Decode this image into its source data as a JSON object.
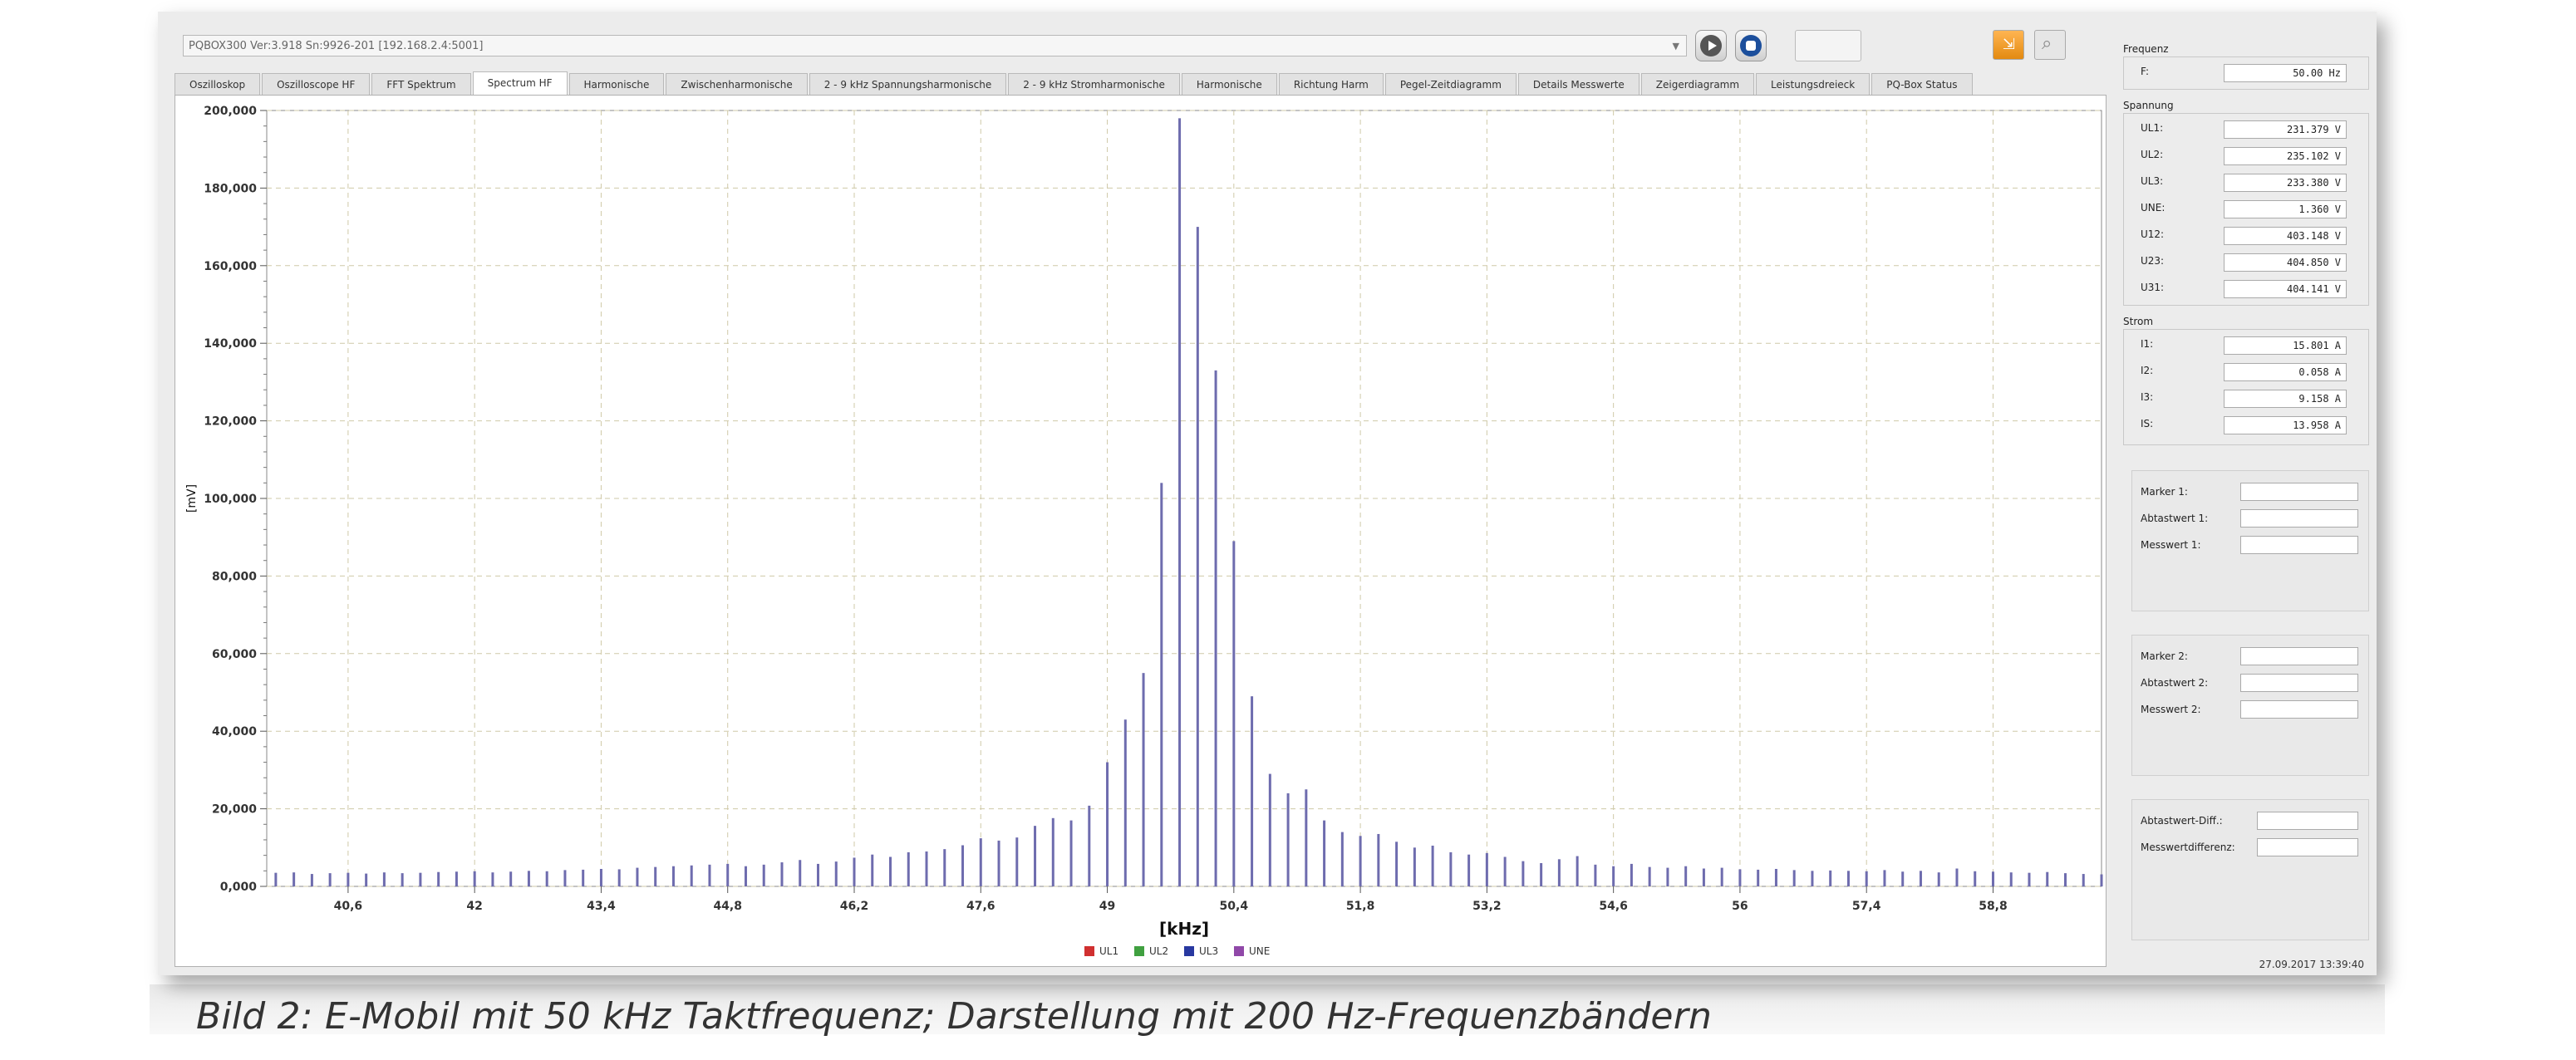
{
  "device_select": "PQBOX300 Ver:3.918 Sn:9926-201 [192.168.2.4:5001]",
  "tabs": [
    "Oszilloskop",
    "Oszilloscope HF",
    "FFT Spektrum",
    "Spectrum HF",
    "Harmonische",
    "Zwischenharmonische",
    "2 - 9 kHz Spannungsharmonische",
    "2 - 9 kHz Stromharmonische",
    "Harmonische",
    "Richtung Harm",
    "Pegel-Zeitdiagramm",
    "Details Messwerte",
    "Zeigerdiagramm",
    "Leistungsdreieck",
    "PQ-Box Status"
  ],
  "active_tab_index": 3,
  "side": {
    "frequenz": {
      "title": "Frequenz",
      "rows": [
        {
          "label": "F:",
          "value": "50.00 Hz"
        }
      ]
    },
    "spannung": {
      "title": "Spannung",
      "rows": [
        {
          "label": "UL1:",
          "value": "231.379 V"
        },
        {
          "label": "UL2:",
          "value": "235.102 V"
        },
        {
          "label": "UL3:",
          "value": "233.380 V"
        },
        {
          "label": "UNE:",
          "value": "1.360 V"
        },
        {
          "label": "U12:",
          "value": "403.148 V"
        },
        {
          "label": "U23:",
          "value": "404.850 V"
        },
        {
          "label": "U31:",
          "value": "404.141 V"
        }
      ]
    },
    "strom": {
      "title": "Strom",
      "rows": [
        {
          "label": "I1:",
          "value": "15.801 A"
        },
        {
          "label": "I2:",
          "value": "0.058 A"
        },
        {
          "label": "I3:",
          "value": "9.158 A"
        },
        {
          "label": "IS:",
          "value": "13.958 A"
        }
      ]
    },
    "marker1": [
      "Marker 1:",
      "Abtastwert 1:",
      "Messwert 1:"
    ],
    "marker2": [
      "Marker 2:",
      "Abtastwert 2:",
      "Messwert 2:"
    ],
    "diff": [
      "Abtastwert-Diff.:",
      "Messwertdifferenz:"
    ],
    "timestamp": "27.09.2017 13:39:40"
  },
  "caption": "Bild 2: E-Mobil mit 50 kHz Taktfrequenz; Darstellung mit 200 Hz-Frequenzbändern",
  "chart_data": {
    "type": "bar",
    "xlabel": "[kHz]",
    "ylabel": "[mV]",
    "xlim": [
      39.7,
      60.0
    ],
    "ylim": [
      0,
      200000
    ],
    "x_ticks": [
      "40,6",
      "42",
      "43,4",
      "44,8",
      "46,2",
      "47,6",
      "49",
      "50,4",
      "51,8",
      "53,2",
      "54,6",
      "56",
      "57,4",
      "58,8"
    ],
    "x_tick_values": [
      40.6,
      42,
      43.4,
      44.8,
      46.2,
      47.6,
      49,
      50.4,
      51.8,
      53.2,
      54.6,
      56,
      57.4,
      58.8
    ],
    "y_ticks": [
      "0,000",
      "20,000",
      "40,000",
      "60,000",
      "80,000",
      "100,000",
      "120,000",
      "140,000",
      "160,000",
      "180,000",
      "200,000"
    ],
    "y_tick_values": [
      0,
      20000,
      40000,
      60000,
      80000,
      100000,
      120000,
      140000,
      160000,
      180000,
      200000
    ],
    "grid": true,
    "legend": [
      {
        "name": "UL1",
        "color": "#d03030"
      },
      {
        "name": "UL2",
        "color": "#40a040"
      },
      {
        "name": "UL3",
        "color": "#2838a0"
      },
      {
        "name": "UNE",
        "color": "#9048a8"
      }
    ],
    "bar_color": "#6e6cae",
    "series": [
      {
        "name": "UL3",
        "x": [
          39.8,
          40.0,
          40.2,
          40.4,
          40.6,
          40.8,
          41.0,
          41.2,
          41.4,
          41.6,
          41.8,
          42.0,
          42.2,
          42.4,
          42.6,
          42.8,
          43.0,
          43.2,
          43.4,
          43.6,
          43.8,
          44.0,
          44.2,
          44.4,
          44.6,
          44.8,
          45.0,
          45.2,
          45.4,
          45.6,
          45.8,
          46.0,
          46.2,
          46.4,
          46.6,
          46.8,
          47.0,
          47.2,
          47.4,
          47.6,
          47.8,
          48.0,
          48.2,
          48.4,
          48.6,
          48.8,
          49.0,
          49.2,
          49.4,
          49.6,
          49.8,
          50.0,
          50.2,
          50.4,
          50.6,
          50.8,
          51.0,
          51.2,
          51.4,
          51.6,
          51.8,
          52.0,
          52.2,
          52.4,
          52.6,
          52.8,
          53.0,
          53.2,
          53.4,
          53.6,
          53.8,
          54.0,
          54.2,
          54.4,
          54.6,
          54.8,
          55.0,
          55.2,
          55.4,
          55.6,
          55.8,
          56.0,
          56.2,
          56.4,
          56.6,
          56.8,
          57.0,
          57.2,
          57.4,
          57.6,
          57.8,
          58.0,
          58.2,
          58.4,
          58.6,
          58.8,
          59.0,
          59.2,
          59.4,
          59.6,
          59.8,
          60.0
        ],
        "values": [
          3500,
          3600,
          3200,
          3400,
          3500,
          3300,
          3600,
          3400,
          3500,
          3700,
          3800,
          3900,
          3600,
          3800,
          4000,
          3900,
          4200,
          4300,
          4500,
          4400,
          4800,
          5000,
          5200,
          5400,
          5600,
          5800,
          5200,
          5600,
          6200,
          6800,
          5800,
          6400,
          7400,
          8200,
          7600,
          8800,
          9000,
          9600,
          10600,
          12400,
          11800,
          12600,
          15600,
          17600,
          17000,
          20800,
          32000,
          43000,
          55000,
          104000,
          198000,
          170000,
          133000,
          89000,
          49000,
          29000,
          24000,
          25000,
          17000,
          14000,
          13000,
          13500,
          11500,
          10000,
          10500,
          8800,
          8200,
          8600,
          7600,
          6500,
          6000,
          7000,
          7800,
          5600,
          5200,
          5800,
          5000,
          4800,
          5200,
          4600,
          4800,
          4400,
          4300,
          4500,
          4200,
          4000,
          4100,
          4000,
          3900,
          4200,
          3800,
          4000,
          3600,
          4600,
          3900,
          3800,
          3600,
          3500,
          3700,
          3400,
          3200,
          3100
        ]
      }
    ]
  }
}
